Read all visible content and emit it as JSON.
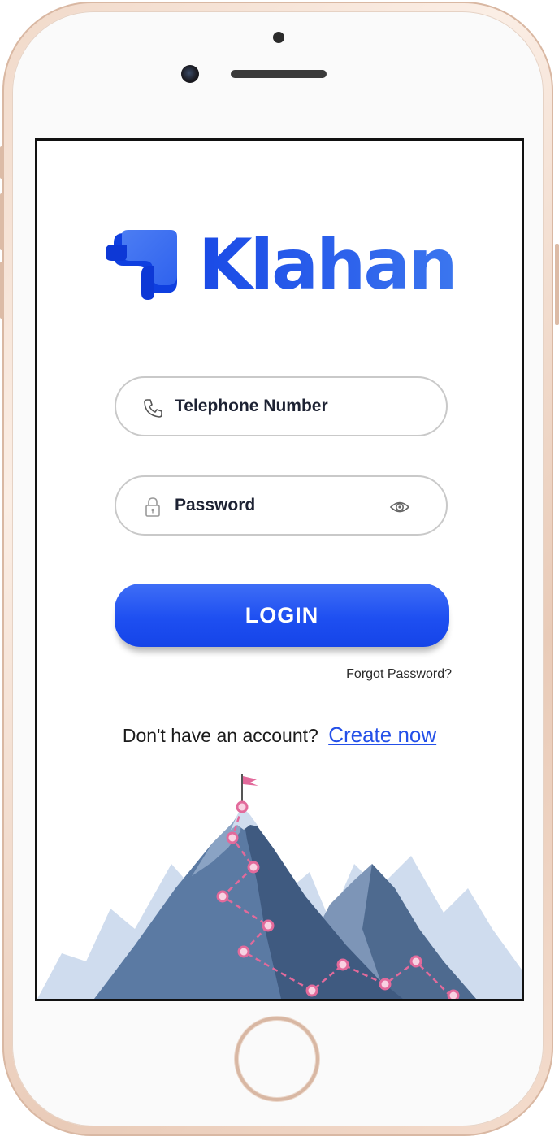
{
  "brand": {
    "name": "Klahan",
    "accent": "#2450e8"
  },
  "form": {
    "phone_placeholder": "Telephone Number",
    "phone_icon": "phone-icon",
    "password_placeholder": "Password",
    "password_icon": "lock-icon",
    "reveal_icon": "eye-icon"
  },
  "actions": {
    "login_label": "LOGIN",
    "forgot_label": "Forgot Password?",
    "signup_prompt": "Don't have an account?",
    "signup_link": "Create now"
  },
  "colors": {
    "button": "#1e4ff1",
    "field_border": "#c9c9c9",
    "link": "#2450e8",
    "path_marker": "#e26a9b"
  }
}
